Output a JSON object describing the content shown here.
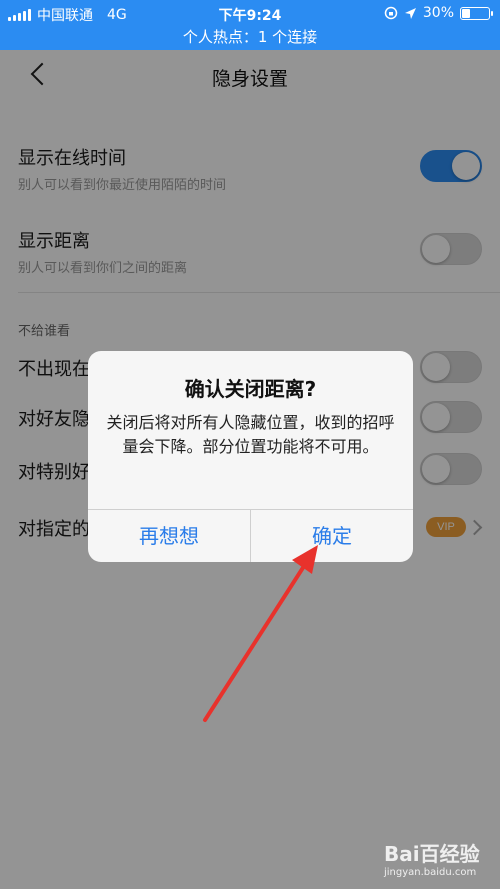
{
  "status_bar": {
    "carrier": "中国联通",
    "network": "4G",
    "time": "下午9:24",
    "battery": "30%",
    "battery_level": 0.3,
    "hotspot": "个人热点：1 个连接"
  },
  "nav": {
    "title": "隐身设置"
  },
  "settings": {
    "show_online_time": {
      "title": "显示在线时间",
      "subtitle": "别人可以看到你最近使用陌陌的时间",
      "enabled": true
    },
    "show_distance": {
      "title": "显示距离",
      "subtitle": "别人可以看到你们之间的距离",
      "enabled": false
    },
    "section_label": "不给谁看",
    "items": [
      {
        "title": "不出现在"
      },
      {
        "title": "对好友隐"
      },
      {
        "title": "对特别好"
      },
      {
        "title": "对指定的",
        "badge": "VIP"
      }
    ]
  },
  "dialog": {
    "title": "确认关闭距离?",
    "message": "关闭后将对所有人隐藏位置，收到的招呼量会下降。部分位置功能将不可用。",
    "cancel_label": "再想想",
    "confirm_label": "确定"
  },
  "colors": {
    "accent": "#2b8cf2",
    "vip": "#f0a03c",
    "annotation_arrow": "#e8322c"
  },
  "watermark": {
    "main": "Bai百经验",
    "sub": "jingyan.baidu.com"
  }
}
